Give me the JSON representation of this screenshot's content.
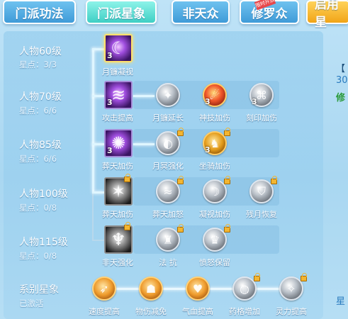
{
  "tabs": [
    {
      "label": "门派功法"
    },
    {
      "label": "门派星象"
    },
    {
      "label": "非天众"
    },
    {
      "label": "修罗众"
    },
    {
      "label": "启用星"
    }
  ],
  "tab_ribbon": "限时开放",
  "levels": [
    {
      "label": "人物60级",
      "stars": "星点：3/3"
    },
    {
      "label": "人物70级",
      "stars": "星点：6/6"
    },
    {
      "label": "人物85级",
      "stars": "星点：6/6"
    },
    {
      "label": "人物100级",
      "stars": "星点：0/8"
    },
    {
      "label": "人物115级",
      "stars": "星点：0/8"
    }
  ],
  "skills": {
    "r1": {
      "main": "月镰凝视",
      "main_count": "3"
    },
    "r2": {
      "main": "攻击提高",
      "main_count": "3",
      "n1": "月镰延长",
      "n2": "神技加伤",
      "n2_count": "3",
      "n3": "刻印加伤",
      "n3_count": "3"
    },
    "r3": {
      "main": "葬天加伤",
      "main_count": "3",
      "n1": "月冥强化",
      "n2": "坐骑加伤",
      "n2_count": "3"
    },
    "r4": {
      "main": "葬天加伤",
      "n1": "葬天加怒",
      "n2": "凝视加伤",
      "n3": "残月恢复"
    },
    "r5": {
      "main": "非天强化",
      "n1": "法 抗",
      "n2": "愤怒保留"
    }
  },
  "series": {
    "title": "系别星象",
    "status": "已激活",
    "items": [
      {
        "label": "速度提高"
      },
      {
        "label": "物伤减免"
      },
      {
        "label": "气血提高"
      },
      {
        "label": "药格增加"
      },
      {
        "label": "灵力提高"
      }
    ]
  },
  "side": {
    "bracket": "【",
    "num": "30",
    "green": "修",
    "bottom": "星"
  }
}
